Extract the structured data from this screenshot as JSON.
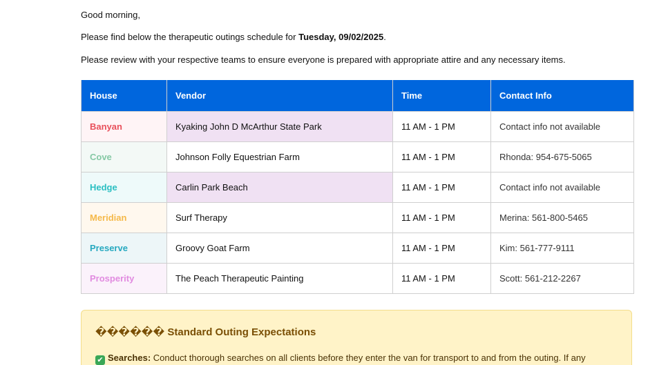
{
  "email": {
    "greeting": "Good morning,",
    "intro_prefix": "Please find below the therapeutic outings schedule for ",
    "intro_date": "Tuesday, 09/02/2025",
    "intro_suffix": ".",
    "review": "Please review with your respective teams to ensure everyone is prepared with appropriate attire and any necessary items."
  },
  "table": {
    "headers": [
      "House",
      "Vendor",
      "Time",
      "Contact Info"
    ],
    "rows": [
      {
        "house": "Banyan",
        "vendor": "Kyaking John D McArthur State Park",
        "time": "11 AM - 1 PM",
        "contact": "Contact info not available",
        "house_color": "#e8505b",
        "row_bg": "#fff4f6",
        "vendor_highlight": true
      },
      {
        "house": "Cove",
        "vendor": "Johnson Folly Equestrian Farm",
        "time": "11 AM - 1 PM",
        "contact": "Rhonda: 954-675-5065",
        "house_color": "#86c9a5",
        "row_bg": "#f3f9f6",
        "vendor_highlight": false
      },
      {
        "house": "Hedge",
        "vendor": "Carlin Park Beach",
        "time": "11 AM - 1 PM",
        "contact": "Contact info not available",
        "house_color": "#2bbfc2",
        "row_bg": "#eefafa",
        "vendor_highlight": true
      },
      {
        "house": "Meridian",
        "vendor": "Surf Therapy",
        "time": "11 AM - 1 PM",
        "contact": "Merina: 561-800-5465",
        "house_color": "#f5b94a",
        "row_bg": "#fff8ee",
        "vendor_highlight": false
      },
      {
        "house": "Preserve",
        "vendor": "Groovy Goat Farm",
        "time": "11 AM - 1 PM",
        "contact": "Kim: 561-777-9111",
        "house_color": "#27a9c0",
        "row_bg": "#edf6f8",
        "vendor_highlight": false
      },
      {
        "house": "Prosperity",
        "vendor": "The Peach Therapeutic Painting",
        "time": "11 AM - 1 PM",
        "contact": "Scott: 561-212-2267",
        "house_color": "#e18be0",
        "row_bg": "#fbf2fb",
        "vendor_highlight": false
      }
    ]
  },
  "expectations": {
    "title": "������ Standard Outing Expectations",
    "item_label": "Searches:",
    "item_text": " Conduct thorough searches on all clients before they enter the van for transport to and from the outing. If any",
    "check_icon": "check-mark-button-icon"
  },
  "colors": {
    "header_bg": "#0066dd",
    "vendor_highlight_bg": "#f0e1f3",
    "expect_bg": "#fff3c8",
    "expect_title": "#7a4f05"
  }
}
